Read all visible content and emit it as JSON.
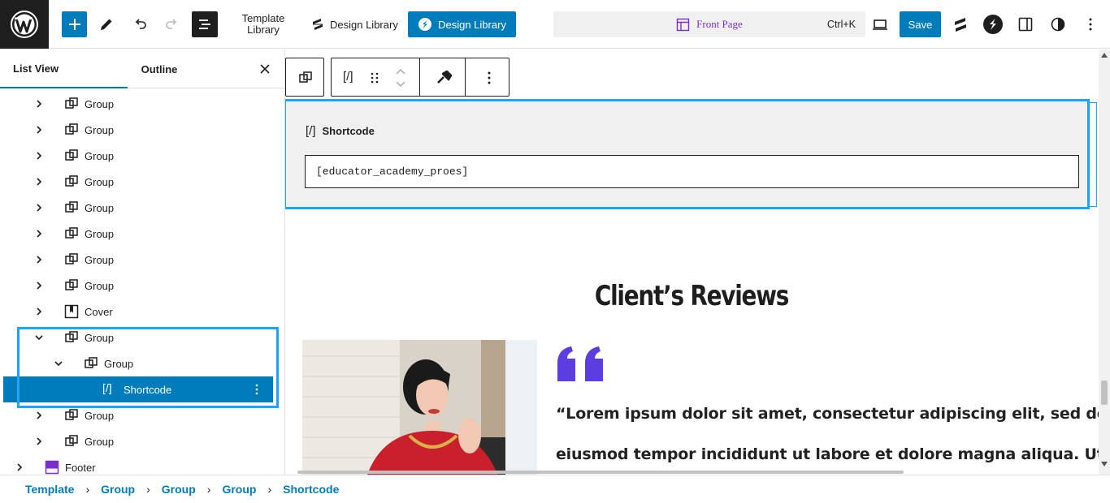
{
  "header": {
    "template_library": "Template Library",
    "design_library_1": "Design Library",
    "design_library_2": "Design Library",
    "page_title": "Front Page",
    "shortcut": "Ctrl+K",
    "save": "Save"
  },
  "sidebar": {
    "tabs": [
      "List View",
      "Outline"
    ],
    "rows": [
      {
        "label": "Group",
        "expanded": false,
        "depth": 1,
        "icon": "group-icon"
      },
      {
        "label": "Group",
        "expanded": false,
        "depth": 1,
        "icon": "group-icon"
      },
      {
        "label": "Group",
        "expanded": false,
        "depth": 1,
        "icon": "group-icon"
      },
      {
        "label": "Group",
        "expanded": false,
        "depth": 1,
        "icon": "group-icon"
      },
      {
        "label": "Group",
        "expanded": false,
        "depth": 1,
        "icon": "group-icon"
      },
      {
        "label": "Group",
        "expanded": false,
        "depth": 1,
        "icon": "group-icon"
      },
      {
        "label": "Group",
        "expanded": false,
        "depth": 1,
        "icon": "group-icon"
      },
      {
        "label": "Group",
        "expanded": false,
        "depth": 1,
        "icon": "group-icon"
      },
      {
        "label": "Cover",
        "expanded": false,
        "depth": 1,
        "icon": "cover-icon"
      },
      {
        "label": "Group",
        "expanded": true,
        "depth": 1,
        "icon": "group-icon"
      },
      {
        "label": "Group",
        "expanded": true,
        "depth": 2,
        "icon": "group-icon"
      },
      {
        "label": "Shortcode",
        "expanded": false,
        "depth": 3,
        "icon": "shortcode-icon",
        "selected": true
      },
      {
        "label": "Group",
        "expanded": false,
        "depth": 1,
        "icon": "group-icon"
      },
      {
        "label": "Group",
        "expanded": false,
        "depth": 1,
        "icon": "group-icon"
      },
      {
        "label": "Footer",
        "expanded": false,
        "depth": 0,
        "icon": "footer-icon"
      }
    ]
  },
  "block": {
    "label": "Shortcode",
    "value": "[educator_academy_proes]"
  },
  "content": {
    "reviews_title": "Client’s Reviews",
    "quote_line1": "“Lorem ipsum dolor sit amet, consectetur adipiscing elit, sed do",
    "quote_line2": "eiusmod tempor incididunt ut labore et dolore magna aliqua. Ut"
  },
  "breadcrumb": [
    "Template",
    "Group",
    "Group",
    "Group",
    "Shortcode"
  ],
  "colors": {
    "accent": "#007cba",
    "selection": "#1aa3ff",
    "quote_mark": "#5b3de0",
    "page_title": "#7a2ecb"
  }
}
